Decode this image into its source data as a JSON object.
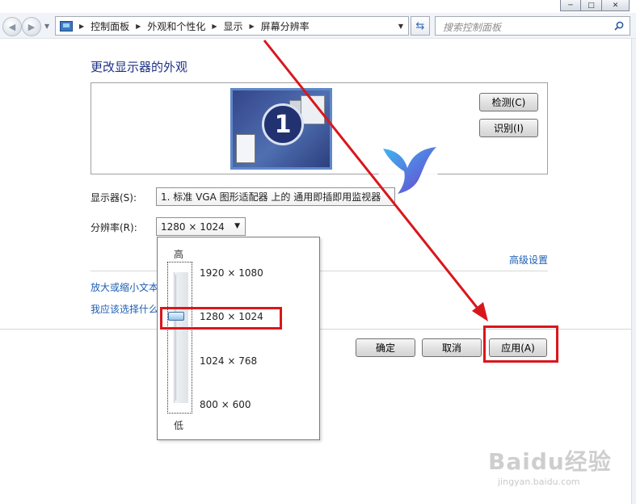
{
  "window": {
    "min": "─",
    "max": "□",
    "close": "✕"
  },
  "address_bar": {
    "breadcrumbs": [
      "控制面板",
      "外观和个性化",
      "显示",
      "屏幕分辨率"
    ]
  },
  "search": {
    "placeholder": "搜索控制面板"
  },
  "main": {
    "title": "更改显示器的外观",
    "monitor_number": "1",
    "detect_button": "检测(C)",
    "identify_button": "识别(I)",
    "display_label": "显示器(S):",
    "display_value": "1. 标准 VGA 图形适配器 上的 通用即插即用监视器",
    "resolution_label": "分辨率(R):",
    "resolution_value": "1280 × 1024",
    "advanced_link": "高级设置",
    "link_text_size": "放大或缩小文本",
    "link_which": "我应该选择什么",
    "ok_button": "确定",
    "cancel_button": "取消",
    "apply_button": "应用(A)"
  },
  "resolution_dropdown": {
    "high_label": "高",
    "low_label": "低",
    "options": [
      "1920 × 1080",
      "1280 × 1024",
      "1024 × 768",
      "800 × 600"
    ],
    "selected_index": 1
  },
  "annotation_color": "#d8171c",
  "watermark": {
    "logo": "Baidu经验",
    "url": "jingyan.baidu.com"
  }
}
